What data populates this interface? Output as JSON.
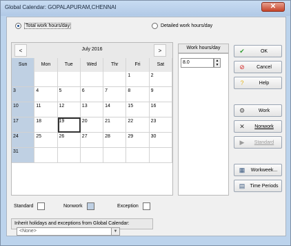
{
  "window": {
    "title": "Global Calendar: GOPALAPURAM,CHENNAI",
    "close_glyph": "✕"
  },
  "mode": {
    "option_total": "Total work hours/day",
    "option_detailed": "Detailed work hours/day",
    "selected": "total"
  },
  "calendar": {
    "prev_glyph": "<",
    "next_glyph": ">",
    "month_label": "July 2016",
    "days_of_week": [
      "Sun",
      "Mon",
      "Tue",
      "Wed",
      "Thr",
      "Fri",
      "Sat"
    ],
    "weeks": [
      [
        "",
        "",
        "",
        "",
        "",
        "1",
        "2"
      ],
      [
        "3",
        "4",
        "5",
        "6",
        "7",
        "8",
        "9"
      ],
      [
        "10",
        "11",
        "12",
        "13",
        "14",
        "15",
        "16"
      ],
      [
        "17",
        "18",
        "19",
        "20",
        "21",
        "22",
        "23"
      ],
      [
        "24",
        "25",
        "26",
        "27",
        "28",
        "29",
        "30"
      ],
      [
        "31",
        "",
        "",
        "",
        "",
        "",
        ""
      ]
    ],
    "selected_day": "19"
  },
  "work_hours": {
    "label": "Work hours/day",
    "value": "8.0"
  },
  "legend": {
    "standard": "Standard",
    "nonwork": "Nonwork",
    "exception": "Exception"
  },
  "inherit": {
    "label": "Inherit holidays and exceptions from Global Calendar:",
    "value": "<None>"
  },
  "buttons": {
    "ok": "OK",
    "cancel": "Cancel",
    "help": "Help",
    "work": "Work",
    "nonwork": "Nonwork",
    "standard": "Standard",
    "workweek": "Workweek...",
    "time_periods": "Time Periods"
  },
  "icons": {
    "ok": "check-icon",
    "cancel": "cancel-icon",
    "help": "help-icon",
    "work": "work-icon",
    "nonwork": "nonwork-icon",
    "standard": "standard-icon",
    "workweek": "workweek-icon",
    "time_periods": "time-periods-icon"
  },
  "colors": {
    "sunday_shade": "#bfd0e3",
    "ok_check": "#2f9b2f",
    "cancel_red": "#d3211f",
    "help_yellow": "#e3b51d"
  }
}
